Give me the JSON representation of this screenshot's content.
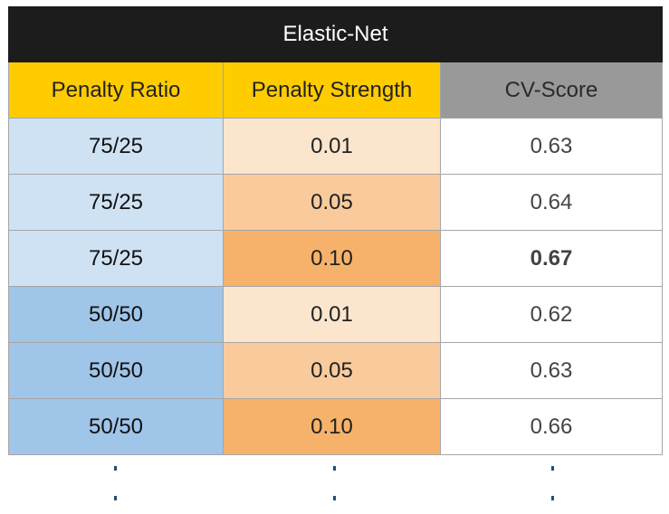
{
  "title": "Elastic-Net",
  "columns": [
    "Penalty Ratio",
    "Penalty Strength",
    "CV-Score"
  ],
  "rows": [
    {
      "ratio": "75/25",
      "strength": "0.01",
      "score": "0.63"
    },
    {
      "ratio": "75/25",
      "strength": "0.05",
      "score": "0.64"
    },
    {
      "ratio": "75/25",
      "strength": "0.10",
      "score": "0.67",
      "best": true
    },
    {
      "ratio": "50/50",
      "strength": "0.01",
      "score": "0.62"
    },
    {
      "ratio": "50/50",
      "strength": "0.05",
      "score": "0.63"
    },
    {
      "ratio": "50/50",
      "strength": "0.10",
      "score": "0.66"
    }
  ],
  "continuation": "vertical ellipsis",
  "colors": {
    "title_bg": "#1c1c1c",
    "header_yellow": "#ffcc00",
    "header_gray": "#999999",
    "ratio_75_25": "#cfe2f3",
    "ratio_50_50": "#9fc5e8",
    "strength_low": "#fce5cd",
    "strength_mid": "#f9cb9c",
    "strength_high": "#f6b26b"
  }
}
